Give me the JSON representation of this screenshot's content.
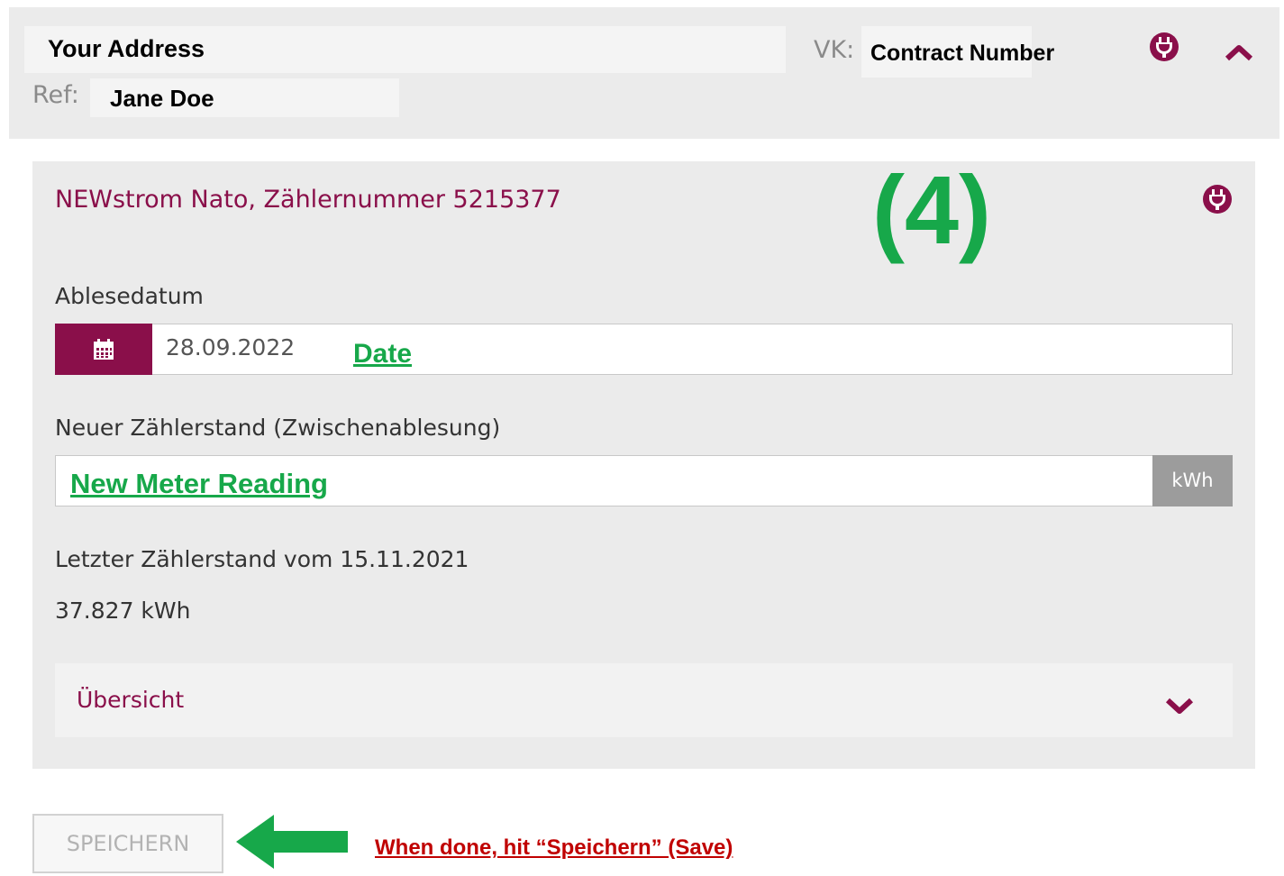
{
  "header": {
    "address": "Your Address",
    "vk_label": "VK:",
    "contract_number": "Contract Number",
    "ref_label": "Ref:",
    "name": "Jane Doe",
    "plug_icon": "plug-icon",
    "collapse_icon": "chevron-up-icon"
  },
  "meter": {
    "title": "NEWstrom Nato, Zählernummer 5215377",
    "plug_icon": "plug-icon",
    "date_label": "Ablesedatum",
    "calendar_icon": "calendar-icon",
    "date_value": "28.09.2022",
    "new_reading_label": "Neuer Zählerstand (Zwischenablesung)",
    "unit": "kWh",
    "last_reading_label": "Letzter Zählerstand vom 15.11.2021",
    "last_reading_value": "37.827 kWh",
    "overview_label": "Übersicht",
    "overview_icon": "chevron-down-icon"
  },
  "annotations": {
    "step_number": "(4)",
    "date_hint": "Date",
    "reading_hint": "New Meter Reading",
    "save_hint": "When done, hit “Speichern” (Save)"
  },
  "actions": {
    "save_label": "SPEICHERN"
  },
  "colors": {
    "brand": "#8a0f4a",
    "annotation_green": "#17a84a",
    "annotation_red": "#c00000"
  }
}
